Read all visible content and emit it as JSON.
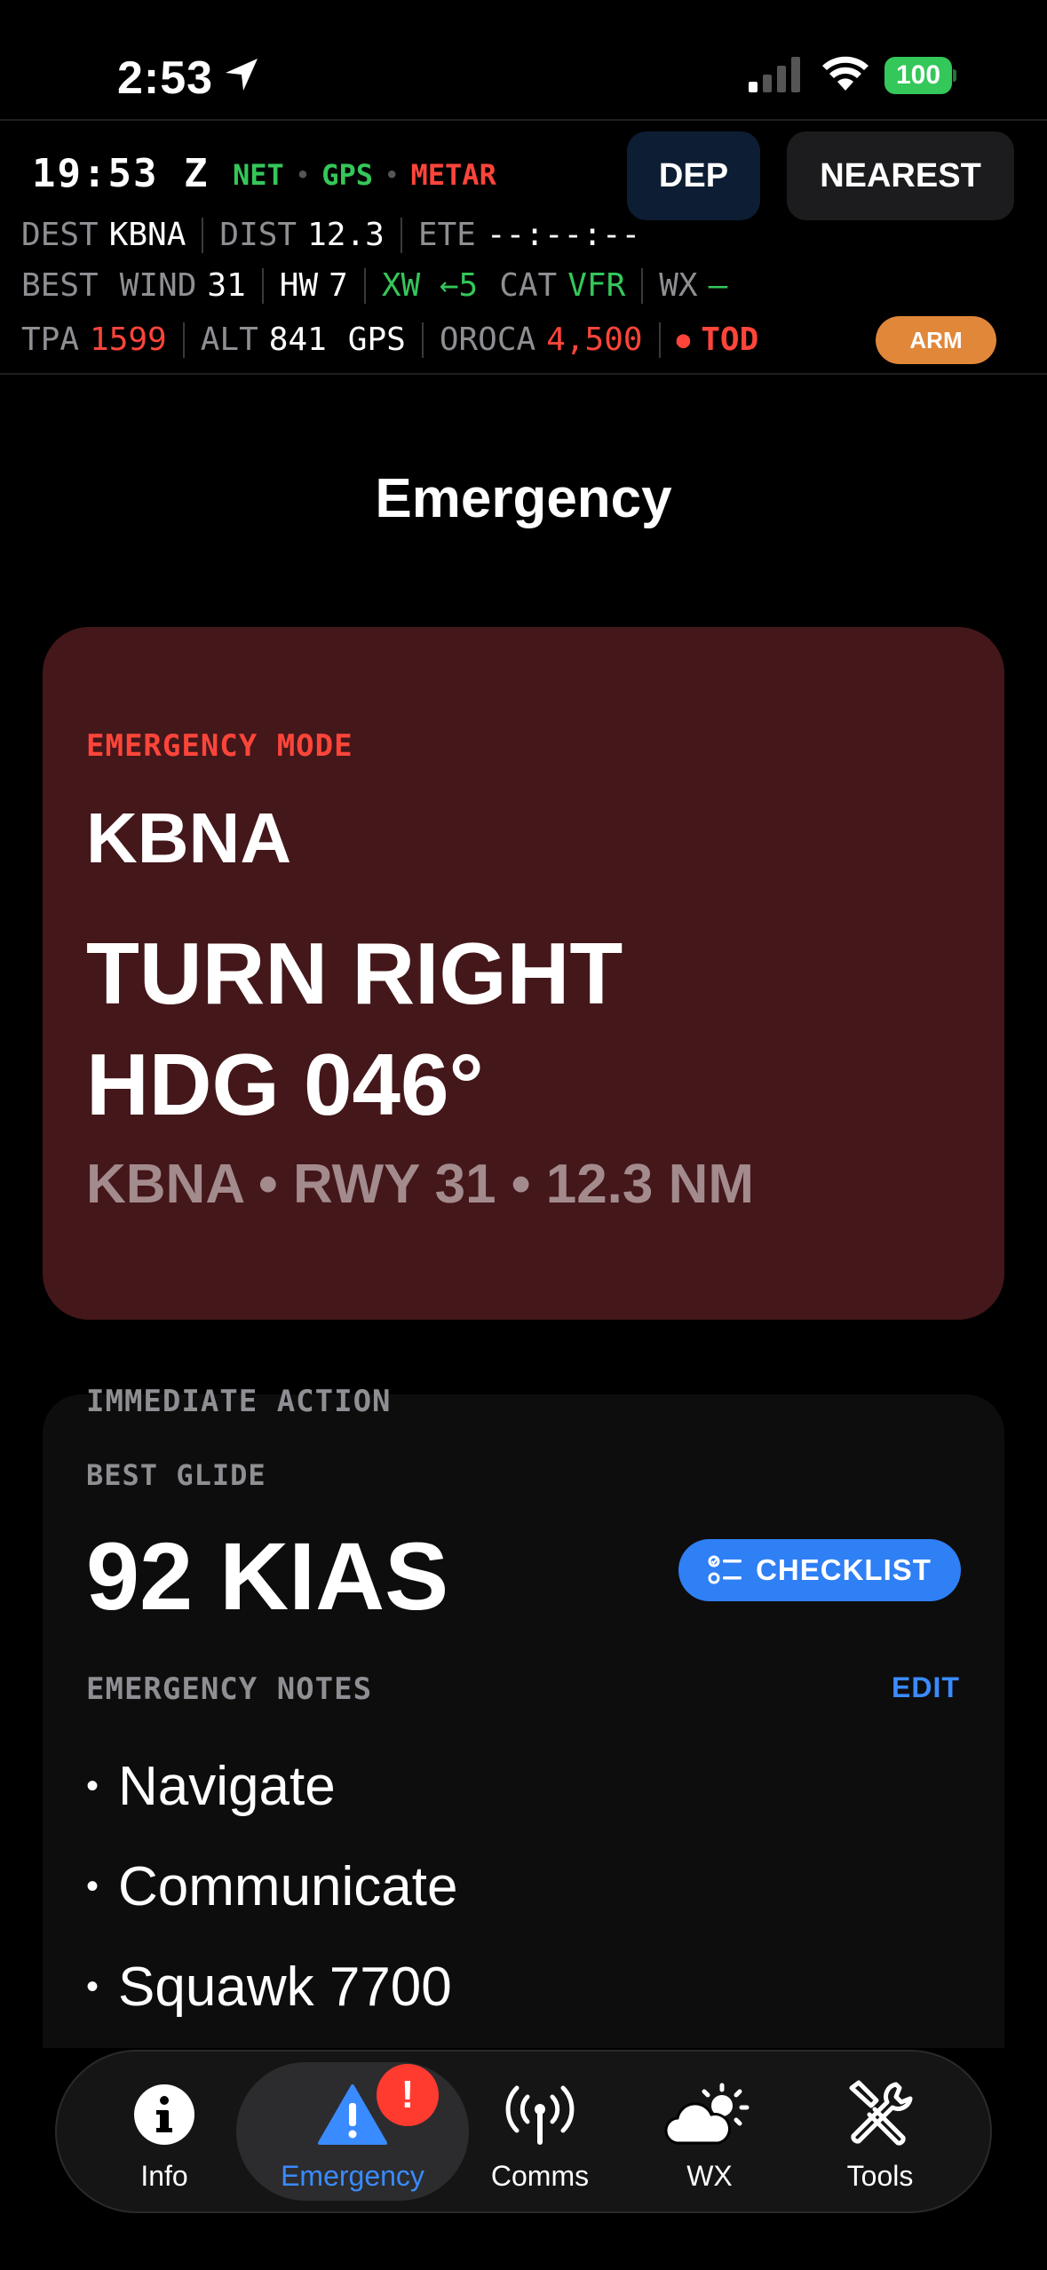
{
  "status_bar": {
    "time": "2:53",
    "battery": "100"
  },
  "header": {
    "zulu": "19:53 Z",
    "flags": {
      "net": "NET",
      "gps": "GPS",
      "metar": "METAR",
      "dot": "•"
    },
    "dep_label": "DEP",
    "nearest_label": "NEAREST",
    "row1": {
      "dest_label": "DEST",
      "dest": "KBNA",
      "dist_label": "DIST",
      "dist": "12.3",
      "ete_label": "ETE",
      "ete": "--:--:--"
    },
    "row2": {
      "best_label": "BEST",
      "wind_label": "WIND",
      "wind": "31",
      "hw_label": "HW",
      "hw": "7",
      "xw": "XW ←5",
      "cat_label": "CAT",
      "cat": "VFR",
      "wx_label": "WX",
      "wx": "—"
    },
    "row3": {
      "tpa_label": "TPA",
      "tpa": "1599",
      "alt_label": "ALT",
      "alt": "841",
      "alt_src": "GPS",
      "oroca_label": "OROCA",
      "oroca": "4,500",
      "tod_dot": "●",
      "tod_label": "TOD",
      "arm_label": "ARM"
    }
  },
  "page_title": "Emergency",
  "emergency_card": {
    "mode_label": "EMERGENCY MODE",
    "airport": "KBNA",
    "turn_line1": "TURN RIGHT",
    "turn_line2": "HDG 046°",
    "summary": "KBNA • RWY 31 • 12.3 NM"
  },
  "immediate_action": {
    "section_label": "IMMEDIATE ACTION",
    "best_glide_label": "BEST GLIDE",
    "best_glide_value": "92 KIAS",
    "checklist_label": "CHECKLIST",
    "notes_label": "EMERGENCY NOTES",
    "edit_label": "EDIT",
    "bullet": "•",
    "notes": [
      "Navigate",
      "Communicate",
      "Squawk 7700"
    ]
  },
  "tabs": [
    {
      "label": "Info",
      "icon": "info-icon"
    },
    {
      "label": "Emergency",
      "icon": "warning-icon",
      "badge": "!"
    },
    {
      "label": "Comms",
      "icon": "antenna-icon"
    },
    {
      "label": "WX",
      "icon": "weather-icon"
    },
    {
      "label": "Tools",
      "icon": "tools-icon"
    }
  ],
  "colors": {
    "accent_blue": "#2f7ff5",
    "alert_red": "#ff453a",
    "ok_green": "#34c759",
    "arm_orange": "#e0873a",
    "emergency_card": "#44171a"
  }
}
